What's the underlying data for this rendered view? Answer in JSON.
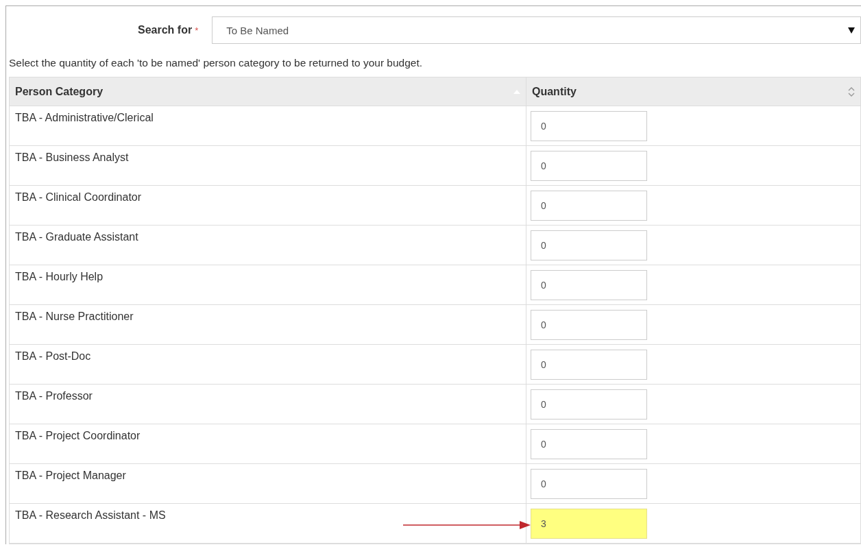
{
  "search": {
    "label": "Search for",
    "required_mark": "*",
    "value": "To Be Named"
  },
  "instruction": "Select the quantity of each 'to be named' person category to be returned to your budget.",
  "table": {
    "columns": [
      "Person Category",
      "Quantity"
    ],
    "rows": [
      {
        "category": "TBA - Administrative/Clerical",
        "quantity": "0",
        "highlighted": false
      },
      {
        "category": "TBA - Business Analyst",
        "quantity": "0",
        "highlighted": false
      },
      {
        "category": "TBA - Clinical Coordinator",
        "quantity": "0",
        "highlighted": false
      },
      {
        "category": "TBA - Graduate Assistant",
        "quantity": "0",
        "highlighted": false
      },
      {
        "category": "TBA - Hourly Help",
        "quantity": "0",
        "highlighted": false
      },
      {
        "category": "TBA - Nurse Practitioner",
        "quantity": "0",
        "highlighted": false
      },
      {
        "category": "TBA - Post-Doc",
        "quantity": "0",
        "highlighted": false
      },
      {
        "category": "TBA - Professor",
        "quantity": "0",
        "highlighted": false
      },
      {
        "category": "TBA - Project Coordinator",
        "quantity": "0",
        "highlighted": false
      },
      {
        "category": "TBA - Project Manager",
        "quantity": "0",
        "highlighted": false
      },
      {
        "category": "TBA - Research Assistant - MS",
        "quantity": "3",
        "highlighted": true
      }
    ]
  }
}
